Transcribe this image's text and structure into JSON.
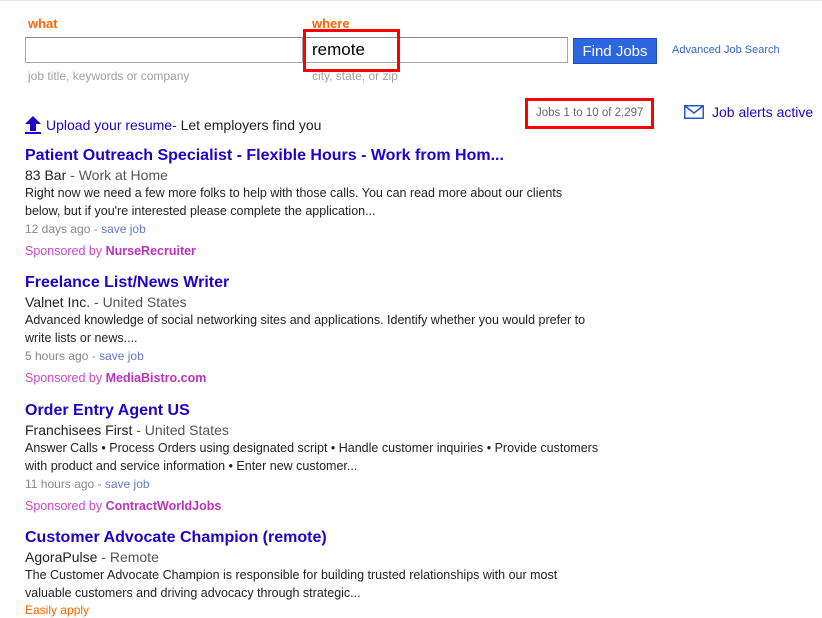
{
  "search": {
    "what_label": "what",
    "what_value": "",
    "what_hint": "job title, keywords or company",
    "where_label": "where",
    "where_value": "remote",
    "where_hint": "city, state, or zip",
    "find_button": "Find Jobs",
    "advanced_link": "Advanced Job Search"
  },
  "upload": {
    "icon": "upload-arrow-icon",
    "link": "Upload your resume",
    "tail": " - Let employers find you"
  },
  "results_count": "Jobs 1 to 10 of 2,297",
  "alerts": {
    "icon": "envelope-icon",
    "label": "Job alerts active"
  },
  "jobs": [
    {
      "title": "Patient Outreach Specialist - Flexible Hours - Work from Hom...",
      "company": "83 Bar",
      "location": " - Work at Home",
      "snippet": "Right now we need a few more folks to help with those calls. You can read more about our clients below, but if you're interested please complete the application...",
      "age": "12 days ago",
      "save": "save job",
      "sponsor_prefix": "Sponsored by ",
      "sponsor": "NurseRecruiter"
    },
    {
      "title": "Freelance List/News Writer",
      "company": "Valnet Inc.",
      "location": " - United States",
      "snippet": "Advanced knowledge of social networking sites and applications. Identify whether you would prefer to write lists or news....",
      "age": "5 hours ago",
      "save": "save job",
      "sponsor_prefix": "Sponsored by ",
      "sponsor": "MediaBistro.com"
    },
    {
      "title": "Order Entry Agent US",
      "company": "Franchisees First",
      "location": " - United States",
      "snippet": "Answer Calls • Process Orders using designated script • Handle customer inquiries • Provide customers with product and service information • Enter new customer...",
      "age": "11 hours ago",
      "save": "save job",
      "sponsor_prefix": "Sponsored by ",
      "sponsor": "ContractWorldJobs"
    },
    {
      "title": "Customer Advocate Champion (remote)",
      "company": "AgoraPulse",
      "location": " - Remote",
      "snippet": "The Customer Advocate Champion is responsible for building trusted relationships with our most valuable customers and driving advocacy through strategic...",
      "easy_apply": "Easily apply"
    }
  ],
  "colors": {
    "label_orange": "#ff6600",
    "link_blue": "#2200cc",
    "button_blue": "#2d67e0",
    "sponsor_purple": "#cc44cc",
    "highlight_red": "#ff0000"
  }
}
